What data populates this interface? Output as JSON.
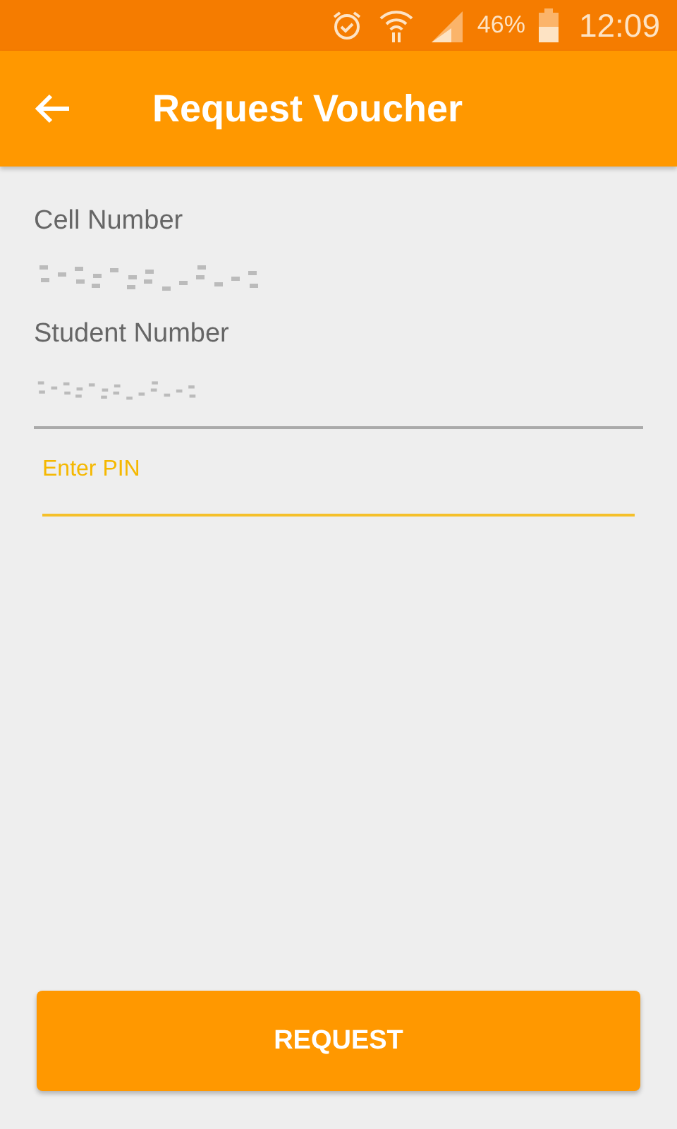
{
  "status_bar": {
    "battery_text": "46%",
    "time": "12:09"
  },
  "app_bar": {
    "title": "Request Voucher"
  },
  "form": {
    "fields": [
      {
        "kind": "readonly",
        "label": "Cell Number",
        "redacted": true
      },
      {
        "kind": "readonly",
        "label": "Student Number",
        "redacted": true
      },
      {
        "kind": "input",
        "placeholder": "Enter PIN",
        "focused": true
      }
    ]
  },
  "button": {
    "label": "REQUEST"
  }
}
